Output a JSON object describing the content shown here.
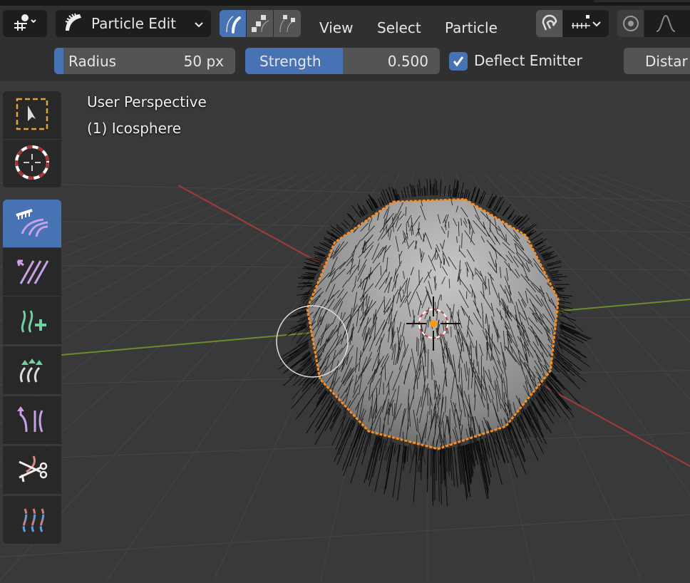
{
  "header": {
    "editor_type_icon": "object-mode-icon",
    "mode": {
      "label": "Particle Edit",
      "icon": "comb-icon"
    },
    "select_modes": [
      {
        "name": "path",
        "active": true
      },
      {
        "name": "point",
        "active": false
      },
      {
        "name": "tip",
        "active": false
      }
    ],
    "menus": [
      "View",
      "Select",
      "Particle"
    ],
    "snapping_icon": "magnet-icon",
    "snap_target_icon": "increment-icon",
    "proportional_icon": "proportional-icon",
    "falloff_icon": "falloff-curve-icon"
  },
  "tool_settings": {
    "radius": {
      "label": "Radius",
      "value": "50 px",
      "fraction": 0.05
    },
    "strength": {
      "label": "Strength",
      "value": "0.500",
      "fraction": 0.5
    },
    "deflect_emitter": {
      "label": "Deflect Emitter",
      "checked": true
    },
    "distance_label": "Distar"
  },
  "viewport": {
    "view_name": "User Perspective",
    "object_name": "(1) Icosphere"
  },
  "toolbar": [
    {
      "name": "select-box",
      "icon": "select-box-icon",
      "active": false
    },
    {
      "name": "cursor",
      "icon": "cursor-icon",
      "active": false
    },
    {
      "name": "comb",
      "icon": "comb-icon",
      "active": true
    },
    {
      "name": "smooth",
      "icon": "smooth-icon",
      "active": false
    },
    {
      "name": "add",
      "icon": "add-hair-icon",
      "active": false
    },
    {
      "name": "length",
      "icon": "length-icon",
      "active": false
    },
    {
      "name": "puff",
      "icon": "puff-icon",
      "active": false
    },
    {
      "name": "cut",
      "icon": "cut-icon",
      "active": false
    },
    {
      "name": "weight",
      "icon": "weight-icon",
      "active": false
    }
  ],
  "colors": {
    "accent": "#4772b3",
    "selection_outline": "#ff8c1a",
    "x_axis": "#a33a3a",
    "y_axis": "#6a8c2a"
  }
}
